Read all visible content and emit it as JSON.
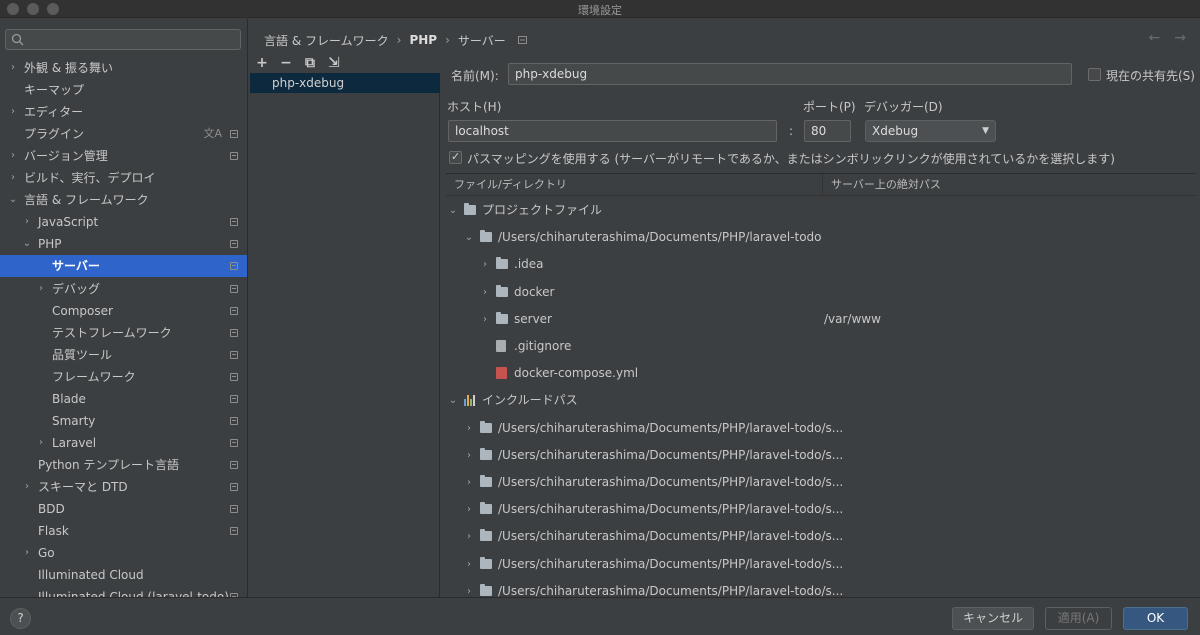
{
  "window": {
    "title": "環境設定"
  },
  "sidebar": {
    "search": {
      "placeholder": ""
    },
    "items": [
      {
        "label": "外観 & 振る舞い",
        "arrow": "›",
        "badge": false
      },
      {
        "label": "キーマップ",
        "arrow": "",
        "badge": false
      },
      {
        "label": "エディター",
        "arrow": "›",
        "badge": false
      },
      {
        "label": "プラグイン",
        "arrow": "",
        "badge": true,
        "trans": "文A"
      },
      {
        "label": "バージョン管理",
        "arrow": "›",
        "badge": true
      },
      {
        "label": "ビルド、実行、デプロイ",
        "arrow": "›",
        "badge": false
      },
      {
        "label": "言語 & フレームワーク",
        "arrow": "⌄",
        "badge": false
      },
      {
        "label": "JavaScript",
        "arrow": "›",
        "badge": true
      },
      {
        "label": "PHP",
        "arrow": "⌄",
        "badge": true
      },
      {
        "label": "サーバー",
        "arrow": "",
        "badge": true,
        "selected": true
      },
      {
        "label": "デバッグ",
        "arrow": "›",
        "badge": true
      },
      {
        "label": "Composer",
        "arrow": "",
        "badge": true
      },
      {
        "label": "テストフレームワーク",
        "arrow": "",
        "badge": true
      },
      {
        "label": "品質ツール",
        "arrow": "",
        "badge": true
      },
      {
        "label": "フレームワーク",
        "arrow": "",
        "badge": true
      },
      {
        "label": "Blade",
        "arrow": "",
        "badge": true
      },
      {
        "label": "Smarty",
        "arrow": "",
        "badge": true
      },
      {
        "label": "Laravel",
        "arrow": "›",
        "badge": true
      },
      {
        "label": "Python テンプレート言語",
        "arrow": "",
        "badge": true
      },
      {
        "label": "スキーマと DTD",
        "arrow": "›",
        "badge": true
      },
      {
        "label": "BDD",
        "arrow": "",
        "badge": true
      },
      {
        "label": "Flask",
        "arrow": "",
        "badge": true
      },
      {
        "label": "Go",
        "arrow": "›",
        "badge": false
      },
      {
        "label": "Illuminated Cloud",
        "arrow": "",
        "badge": false
      },
      {
        "label": "Illuminated Cloud (laravel-todo)",
        "arrow": "",
        "badge": true
      }
    ]
  },
  "breadcrumb": {
    "parts": [
      "言語 & フレームワーク",
      "PHP",
      "サーバー"
    ],
    "separator": "›"
  },
  "servers": {
    "toolbar": {
      "add": "+",
      "remove": "−",
      "copy": "⧉",
      "import": "⇲"
    },
    "items": [
      "php-xdebug"
    ]
  },
  "form": {
    "name_label": "名前(M):",
    "name_value": "php-xdebug",
    "shared_label": "現在の共有先(S)",
    "host_label": "ホスト(H)",
    "host_value": "localhost",
    "colon": ":",
    "port_label": "ポート(P)",
    "port_value": "80",
    "debugger_label": "デバッガー(D)",
    "debugger_value": "Xdebug",
    "pathmap_label": "パスマッピングを使用する (サーバーがリモートであるか、またはシンボリックリンクが使用されているかを選択します)"
  },
  "mapping": {
    "col_file": "ファイル/ディレクトリ",
    "col_abs": "サーバー上の絶対パス",
    "rows": [
      {
        "label": "プロジェクトファイル",
        "arrow": "⌄",
        "icon": "folder",
        "level": 0,
        "map": ""
      },
      {
        "label": "/Users/chiharuterashima/Documents/PHP/laravel-todo",
        "arrow": "⌄",
        "icon": "folder",
        "level": 1,
        "map": ""
      },
      {
        "label": ".idea",
        "arrow": "›",
        "icon": "folder",
        "level": 2,
        "map": ""
      },
      {
        "label": "docker",
        "arrow": "›",
        "icon": "folder",
        "level": 2,
        "map": ""
      },
      {
        "label": "server",
        "arrow": "›",
        "icon": "folder",
        "level": 2,
        "map": "/var/www"
      },
      {
        "label": ".gitignore",
        "arrow": "",
        "icon": "file",
        "level": 2,
        "map": ""
      },
      {
        "label": "docker-compose.yml",
        "arrow": "",
        "icon": "yml",
        "level": 2,
        "map": ""
      },
      {
        "label": "インクルードパス",
        "arrow": "⌄",
        "icon": "library",
        "level": 0,
        "map": ""
      },
      {
        "label": "/Users/chiharuterashima/Documents/PHP/laravel-todo/s...",
        "arrow": "›",
        "icon": "folder",
        "level": 1,
        "map": ""
      },
      {
        "label": "/Users/chiharuterashima/Documents/PHP/laravel-todo/s...",
        "arrow": "›",
        "icon": "folder",
        "level": 1,
        "map": ""
      },
      {
        "label": "/Users/chiharuterashima/Documents/PHP/laravel-todo/s...",
        "arrow": "›",
        "icon": "folder",
        "level": 1,
        "map": ""
      },
      {
        "label": "/Users/chiharuterashima/Documents/PHP/laravel-todo/s...",
        "arrow": "›",
        "icon": "folder",
        "level": 1,
        "map": ""
      },
      {
        "label": "/Users/chiharuterashima/Documents/PHP/laravel-todo/s...",
        "arrow": "›",
        "icon": "folder",
        "level": 1,
        "map": ""
      },
      {
        "label": "/Users/chiharuterashima/Documents/PHP/laravel-todo/s...",
        "arrow": "›",
        "icon": "folder",
        "level": 1,
        "map": ""
      },
      {
        "label": "/Users/chiharuterashima/Documents/PHP/laravel-todo/s...",
        "arrow": "›",
        "icon": "folder",
        "level": 1,
        "map": ""
      }
    ]
  },
  "footer": {
    "help": "?",
    "cancel": "キャンセル",
    "apply": "適用(A)",
    "ok": "OK"
  },
  "colors": {
    "selected": "#2f65ca",
    "ok_button": "#365880",
    "server_selected": "#0d293e"
  }
}
